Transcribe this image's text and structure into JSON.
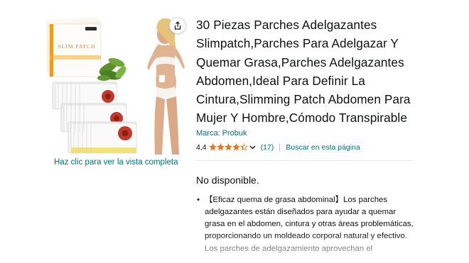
{
  "image": {
    "box_brand_text": "SLIM PATCH",
    "view_full_label": "Haz clic para ver la vista completa",
    "share_icon": "share-icon"
  },
  "product": {
    "title": "30 Piezas Parches Adelgazantes Slimpatch,Parches Para Adelgazar Y Quemar Grasa,Parches Adelgazantes Abdomen,Ideal Para Definir La Cintura,Slimming Patch Abdomen Para Mujer Y Hombre,Cómodo Transpirable",
    "brand_label": "Marca: Probuk",
    "rating_value": "4,4",
    "rating": 4.4,
    "rating_max": 5,
    "review_count": "(17)",
    "search_page_label": "Buscar en esta página",
    "availability": "No disponible.",
    "bullet_1": "【Eficaz quema de grasa abdominal】Los parches adelgazantes están diseñados para ayudar a quemar grasa en el abdomen, cintura y otras áreas problemáticas, proporcionando un moldeado corporal natural y efectivo. Los parches de adelgazamiento aprovechan el"
  },
  "colors": {
    "link": "#007185",
    "star": "#de7921",
    "text": "#0f1111"
  }
}
